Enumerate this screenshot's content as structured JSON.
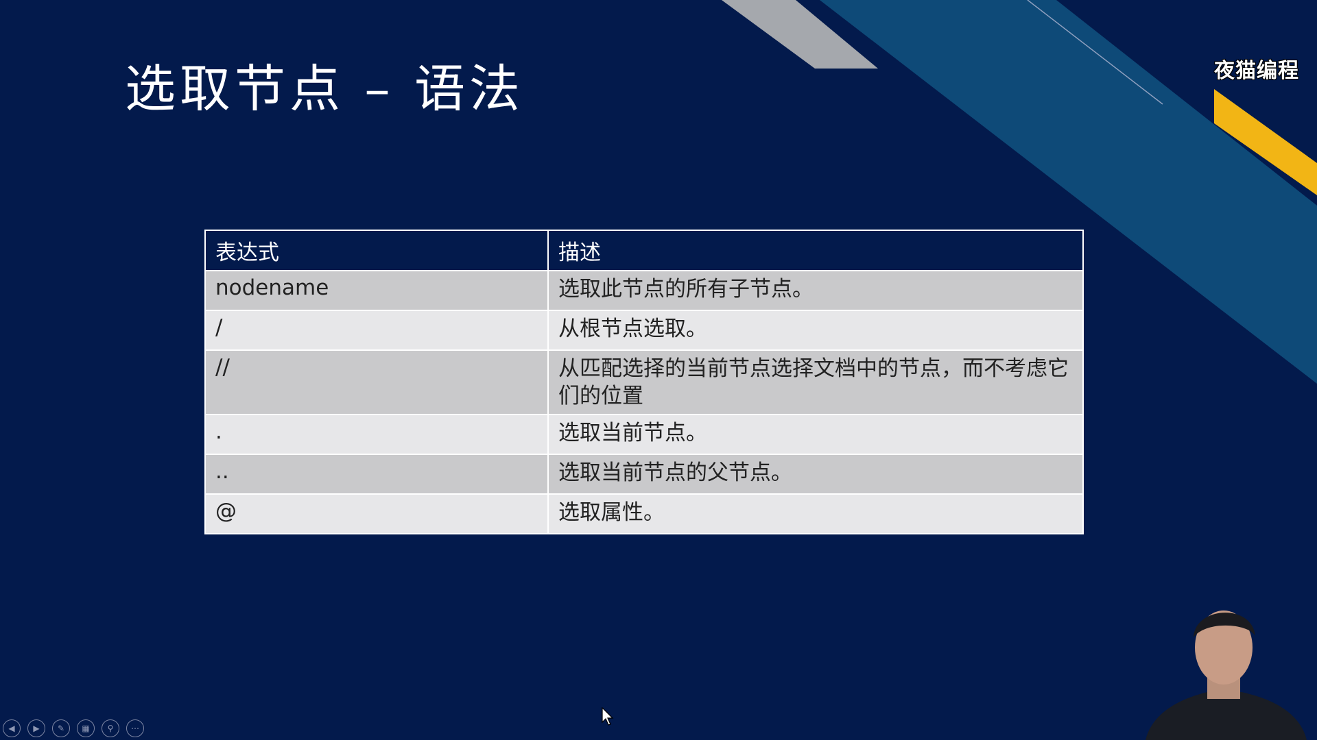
{
  "slide": {
    "title": "选取节点 – 语法",
    "brand_logo": "夜猫编程"
  },
  "table": {
    "headers": [
      "表达式",
      "描述"
    ],
    "rows": [
      {
        "expression": "nodename",
        "description": "选取此节点的所有子节点。"
      },
      {
        "expression": "/",
        "description": "从根节点选取。"
      },
      {
        "expression": "//",
        "description": "从匹配选择的当前节点选择文档中的节点，而不考虑它们的位置"
      },
      {
        "expression": ".",
        "description": "选取当前节点。"
      },
      {
        "expression": "..",
        "description": "选取当前节点的父节点。"
      },
      {
        "expression": "@",
        "description": "选取属性。"
      }
    ]
  },
  "controls": {
    "icons": [
      "previous-icon",
      "next-icon",
      "pen-icon",
      "slides-icon",
      "zoom-icon",
      "more-icon"
    ]
  },
  "colors": {
    "background": "#031a4c",
    "teal_stripe": "#0e4a78",
    "gold_stripe": "#f2b515",
    "gray_stripe": "#a5a8ad",
    "row_odd": "#c9c9cb",
    "row_even": "#e7e7e9"
  }
}
